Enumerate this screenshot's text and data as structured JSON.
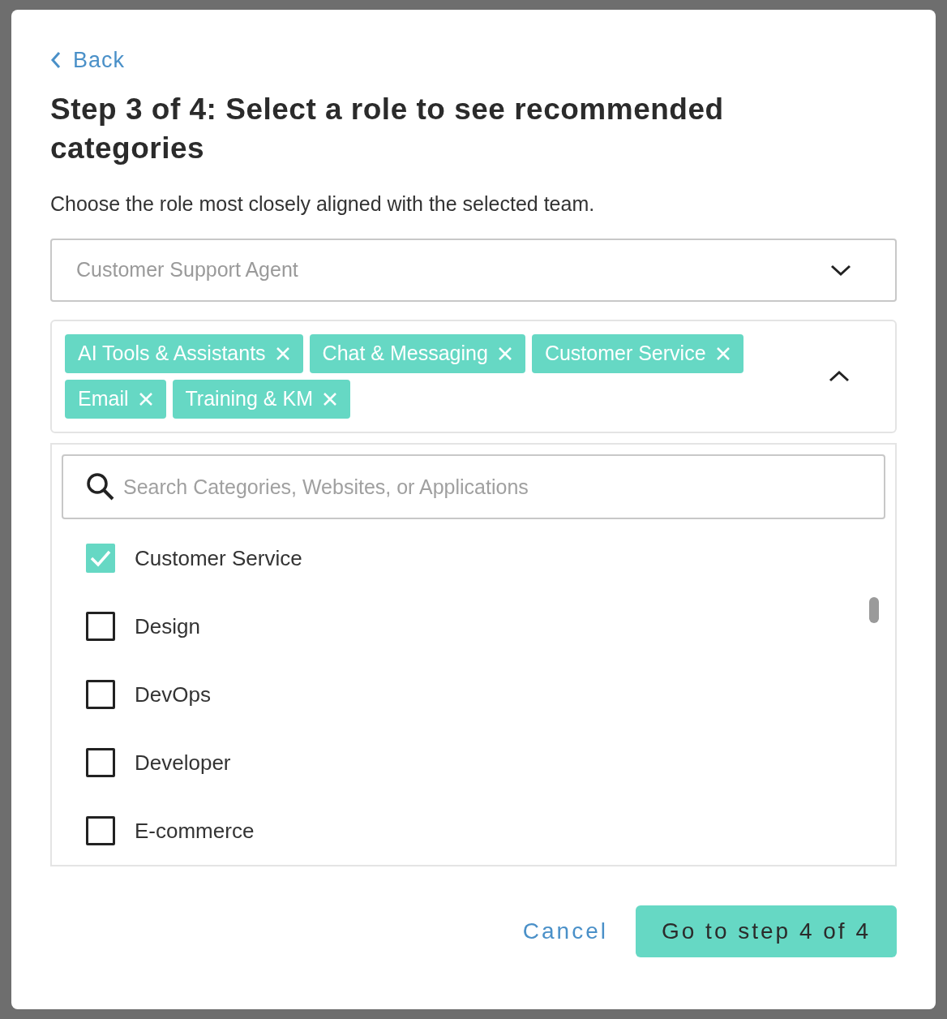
{
  "back_link": "Back",
  "title": "Step 3 of 4: Select a role to see recommended categories",
  "description": "Choose the role most closely aligned with the selected team.",
  "role_select": {
    "value": "Customer Support Agent"
  },
  "selected_tags": {
    "expanded": true,
    "tags": [
      {
        "label": "AI Tools & Assistants"
      },
      {
        "label": "Chat & Messaging"
      },
      {
        "label": "Customer Service"
      },
      {
        "label": "Email"
      },
      {
        "label": "Training & KM"
      }
    ]
  },
  "search": {
    "placeholder": "Search Categories, Websites, or Applications"
  },
  "options": [
    {
      "label": "Customer Service",
      "checked": true
    },
    {
      "label": "Design",
      "checked": false
    },
    {
      "label": "DevOps",
      "checked": false
    },
    {
      "label": "Developer",
      "checked": false
    },
    {
      "label": "E-commerce",
      "checked": false
    }
  ],
  "buttons": {
    "cancel": "Cancel",
    "next": "Go to step 4 of 4"
  }
}
